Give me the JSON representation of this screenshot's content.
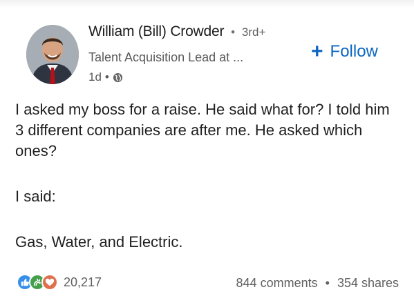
{
  "author": {
    "name": "William (Bill) Crowder",
    "separator": "•",
    "degree": "3rd+",
    "headline": "Talent Acquisition Lead at ...",
    "posted_ago": "1d",
    "visibility_icon": "globe-icon"
  },
  "follow_button": {
    "plus": "+",
    "label": "Follow"
  },
  "post": {
    "paragraph_1": "I asked my boss for a raise. He said what for? I told him 3 different companies are after me. He asked which ones?",
    "paragraph_2": "I said:",
    "paragraph_3": "Gas, Water, and Electric."
  },
  "social": {
    "reaction_icons": [
      "like-icon",
      "celebrate-icon",
      "love-icon"
    ],
    "reaction_count": "20,217",
    "comments": "844 comments",
    "separator": "•",
    "shares": "354 shares"
  },
  "colors": {
    "link_blue": "#0a66c2",
    "like_blue": "#378fe9",
    "celebrate_green": "#44a04c",
    "love_orange": "#df704d"
  }
}
